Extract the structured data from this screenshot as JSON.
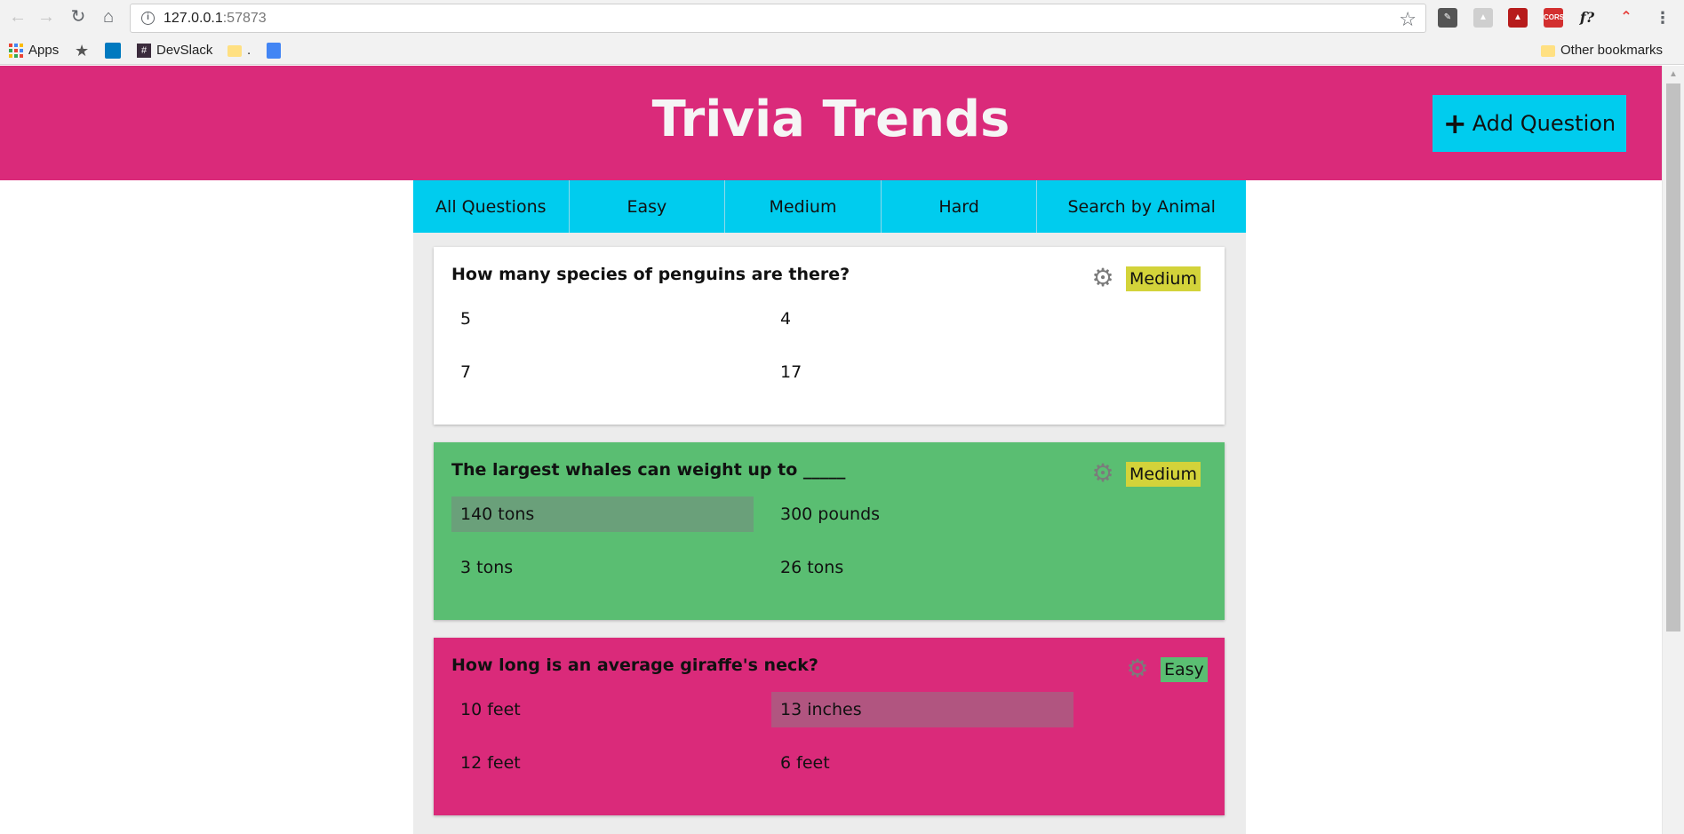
{
  "browser": {
    "url_host": "127.0.0.1",
    "url_port": ":57873",
    "bookmarks": [
      {
        "label": "Apps"
      },
      {
        "label": "DevSlack"
      },
      {
        "label": "."
      },
      {
        "label": "Other bookmarks"
      }
    ],
    "extensions": {
      "cors": "CORS",
      "fx": "f?"
    }
  },
  "header": {
    "title": "Trivia Trends",
    "add_button": "Add Question",
    "add_icon": "+"
  },
  "tabs": [
    {
      "label": "All Questions"
    },
    {
      "label": "Easy"
    },
    {
      "label": "Medium"
    },
    {
      "label": "Hard"
    },
    {
      "label": "Search by Animal"
    }
  ],
  "questions": [
    {
      "text": "How many species of penguins are there?",
      "difficulty": "Medium",
      "answers": [
        "5",
        "4",
        "7",
        "17"
      ]
    },
    {
      "text": "The largest whales can weight up to _____",
      "difficulty": "Medium",
      "answers": [
        "140 tons",
        "300 pounds",
        "3 tons",
        "26 tons"
      ]
    },
    {
      "text": "How long is an average giraffe's neck?",
      "difficulty": "Easy",
      "answers": [
        "10 feet",
        "13 inches",
        "12 feet",
        "6 feet"
      ]
    }
  ],
  "colors": {
    "header_bg": "#da2a7a",
    "tab_bg": "#00ccee",
    "medium_badge": "#d3d33a",
    "easy_badge": "#5abe72",
    "card_green": "#5abe72",
    "card_pink": "#da2a7a"
  }
}
